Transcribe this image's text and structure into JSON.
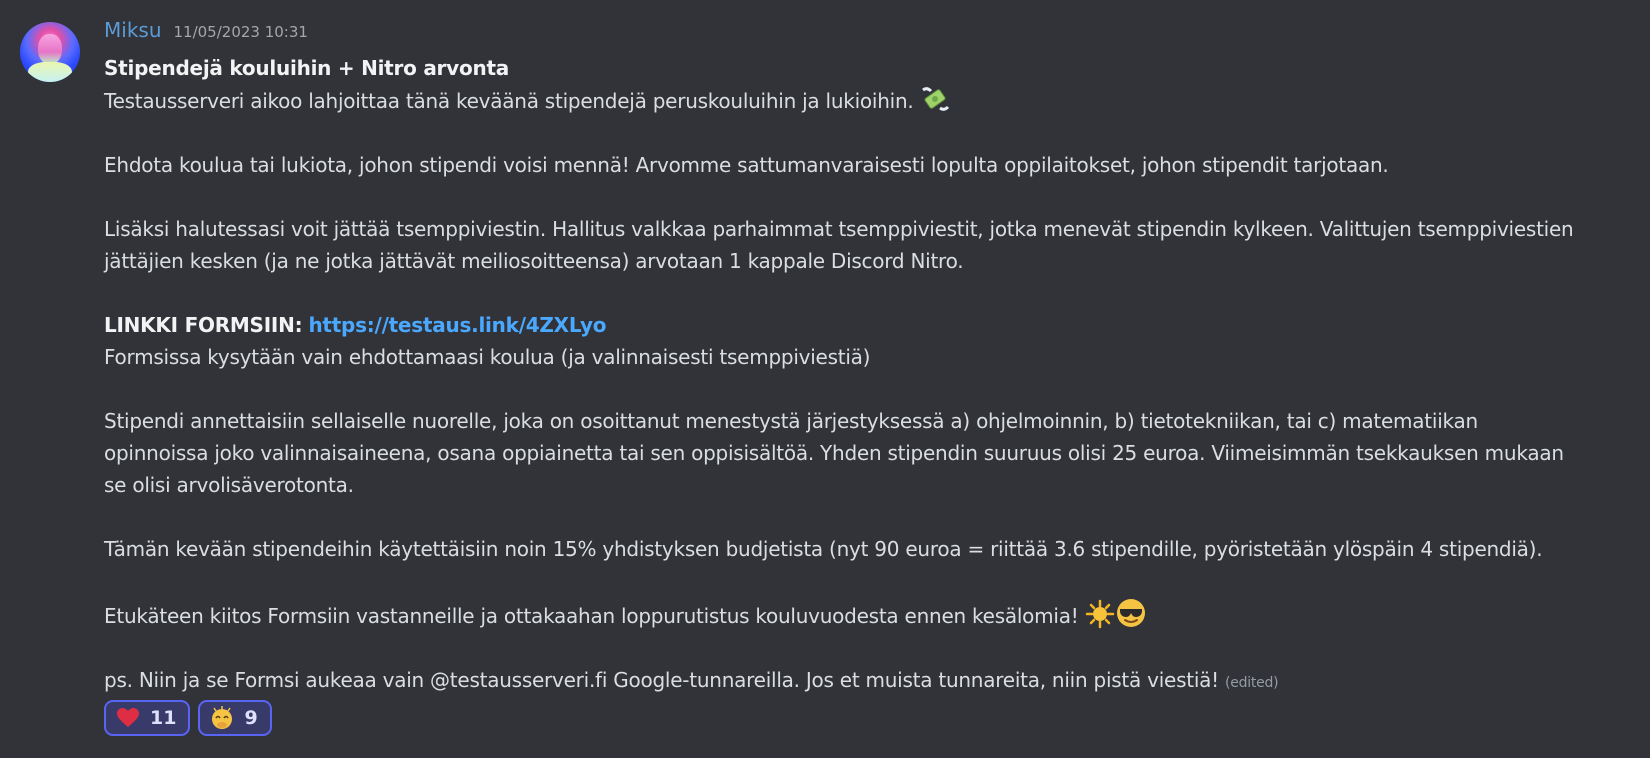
{
  "message": {
    "author": "Miksu",
    "timestamp": "11/05/2023 10:31",
    "title": "Stipendejä kouluihin + Nitro arvonta",
    "line1": "Testausserveri aikoo lahjoittaa tänä keväänä stipendejä peruskouluihin ja lukioihin.",
    "para2": "Ehdota koulua tai lukiota, johon stipendi voisi mennä! Arvomme sattumanvaraisesti lopulta oppilaitokset, johon stipendit tarjotaan.",
    "para3_line1": "Lisäksi halutessasi voit jättää tsemppiviestin. Hallitus valkkaa parhaimmat tsemppiviestit, jotka menevät stipendin kylkeen. Valittujen tsemppiviestien",
    "para3_line2": "jättäjien kesken (ja ne jotka jättävät meiliosoitteensa) arvotaan 1 kappale Discord Nitro.",
    "link_label": "LINKKI FORMSIIN:",
    "link_url": "https://testaus.link/4ZXLyo",
    "forms_note": "Formsissa kysytään vain ehdottamaasi koulua (ja valinnaisesti tsemppiviestiä)",
    "para5_line1": "Stipendi annettaisiin sellaiselle nuorelle, joka on osoittanut menestystä järjestyksessä a) ohjelmoinnin, b) tietotekniikan, tai c) matematiikan",
    "para5_line2": "opinnoissa joko valinnaisaineena, osana oppiainetta tai sen oppisisältöä. Yhden stipendin suuruus olisi 25 euroa. Viimeisimmän tsekkauksen mukaan",
    "para5_line3": "se olisi arvolisäverotonta.",
    "para6": "Tämän kevään stipendeihin käytettäisiin noin 15% yhdistyksen budjetista (nyt 90 euroa = riittää 3.6 stipendille, pyöristetään ylöspäin 4 stipendiä).",
    "para7": "Etukäteen kiitos Formsiin vastanneille ja ottakaahan loppurutistus kouluvuodesta ennen kesälomia!",
    "para8": "ps. Niin ja se Formsi aukeaa vain @testausserveri.fi Google-tunnareilla. Jos et muista tunnareita, niin pistä viestiä!",
    "edited": "(edited)"
  },
  "reactions": [
    {
      "icon": "heart-icon",
      "count": "11"
    },
    {
      "icon": "clap-icon",
      "count": "9"
    }
  ],
  "colors": {
    "background": "#313338",
    "username": "#5c9bd6",
    "link": "#4aa8ff",
    "reaction_border": "#5865f2"
  }
}
